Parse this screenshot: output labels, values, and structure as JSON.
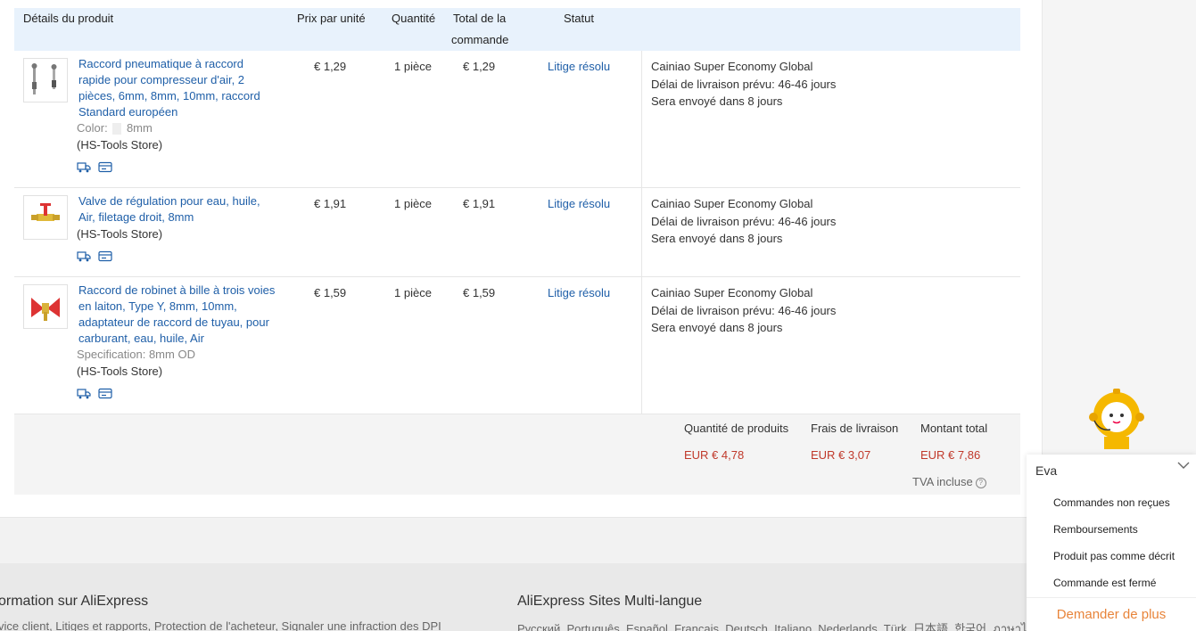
{
  "header": {
    "product_details": "Détails du produit",
    "unit_price": "Prix par unité",
    "quantity": "Quantité",
    "order_total_line1": "Total de la",
    "order_total_line2": "commande",
    "status": "Statut"
  },
  "rows": [
    {
      "title": "Raccord pneumatique à raccord rapide pour compresseur d'air, 2 pièces, 6mm, 8mm, 10mm, raccord Standard européen",
      "sku_label": "Color:",
      "sku_value": "8mm",
      "store": "(HS-Tools Store)",
      "price": "€ 1,29",
      "qty": "1 pièce",
      "total": "€ 1,29",
      "status": "Litige résolu",
      "carrier": "Cainiao Super Economy Global",
      "delivery": "Délai de livraison prévu:  46-46 jours",
      "ship_in": "Sera envoyé dans  8 jours"
    },
    {
      "title": "Valve de régulation pour eau, huile, Air, filetage droit, 8mm",
      "store": "(HS-Tools Store)",
      "price": "€ 1,91",
      "qty": "1 pièce",
      "total": "€ 1,91",
      "status": "Litige résolu",
      "carrier": "Cainiao Super Economy Global",
      "delivery": "Délai de livraison prévu:  46-46 jours",
      "ship_in": "Sera envoyé dans  8 jours"
    },
    {
      "title": "Raccord de robinet à bille à trois voies en laiton, Type Y, 8mm, 10mm, adaptateur de raccord de tuyau, pour carburant, eau, huile, Air",
      "sku_label": "Specification:",
      "sku_value": "8mm OD",
      "store": "(HS-Tools Store)",
      "price": "€ 1,59",
      "qty": "1 pièce",
      "total": "€ 1,59",
      "status": "Litige résolu",
      "carrier": "Cainiao Super Economy Global",
      "delivery": "Délai de livraison prévu:  46-46 jours",
      "ship_in": "Sera envoyé dans  8 jours"
    }
  ],
  "summary": {
    "products_label": "Quantité de produits",
    "products_value": "EUR € 4,78",
    "shipping_label": "Frais de livraison",
    "shipping_value": "EUR € 3,07",
    "total_label": "Montant total",
    "total_value": "EUR € 7,86",
    "vat": "TVA incluse"
  },
  "footer": {
    "left_heading": "ormation sur AliExpress",
    "left_links": "vice client, Litiges et rapports, Protection de l'acheteur, Signaler une infraction des DPI",
    "right_heading": "AliExpress Sites Multi-langue",
    "right_links": "Русский, Português, Español, Français, Deutsch, Italiano, Nederlands, Türk, 日本語, 한국어, ภาษาไทย"
  },
  "chat": {
    "agent_name": "Eva",
    "items": [
      "Commandes non reçues",
      "Remboursements",
      "Produit pas comme décrit",
      "Commande est fermé"
    ],
    "more": "Demander de plus"
  },
  "colors": {
    "link": "#1f5fa8",
    "price_red": "#c0392b",
    "accent_orange": "#e8843a",
    "header_bg": "#e8f2fc"
  },
  "icons": [
    "shipping-truck-icon",
    "card-icon",
    "chevron-down-icon",
    "help-icon",
    "robot-assistant-icon"
  ]
}
